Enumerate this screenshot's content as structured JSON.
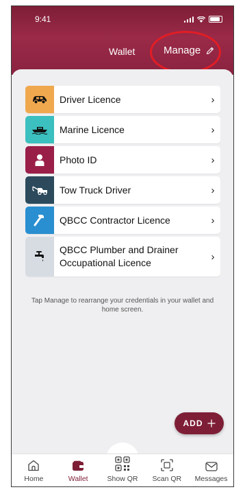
{
  "status_bar": {
    "time": "9:41"
  },
  "header": {
    "title": "Wallet",
    "manage_label": "Manage"
  },
  "credentials": [
    {
      "label": "Driver Licence",
      "color": "#f0a84e",
      "icon": "car-icon"
    },
    {
      "label": "Marine Licence",
      "color": "#3bbfbf",
      "icon": "boat-icon"
    },
    {
      "label": "Photo ID",
      "color": "#9a1f48",
      "icon": "person-icon"
    },
    {
      "label": "Tow Truck Driver",
      "color": "#2c4a5c",
      "icon": "tow-truck-icon"
    },
    {
      "label": "QBCC Contractor Licence",
      "color": "#2a8fd0",
      "icon": "hammer-icon"
    },
    {
      "label": "QBCC Plumber and Drainer Occupational Licence",
      "color": "#d7dce2",
      "icon": "tap-icon"
    }
  ],
  "hint_text": "Tap Manage to rearrange your credentials in your wallet and home screen.",
  "add_button": {
    "label": "ADD"
  },
  "tabs": [
    {
      "label": "Home",
      "active": false
    },
    {
      "label": "Wallet",
      "active": true
    },
    {
      "label": "Show QR",
      "active": false
    },
    {
      "label": "Scan QR",
      "active": false
    },
    {
      "label": "Messages",
      "active": false
    }
  ],
  "colors": {
    "brand": "#7e1e36",
    "annotation": "#e21d25"
  }
}
